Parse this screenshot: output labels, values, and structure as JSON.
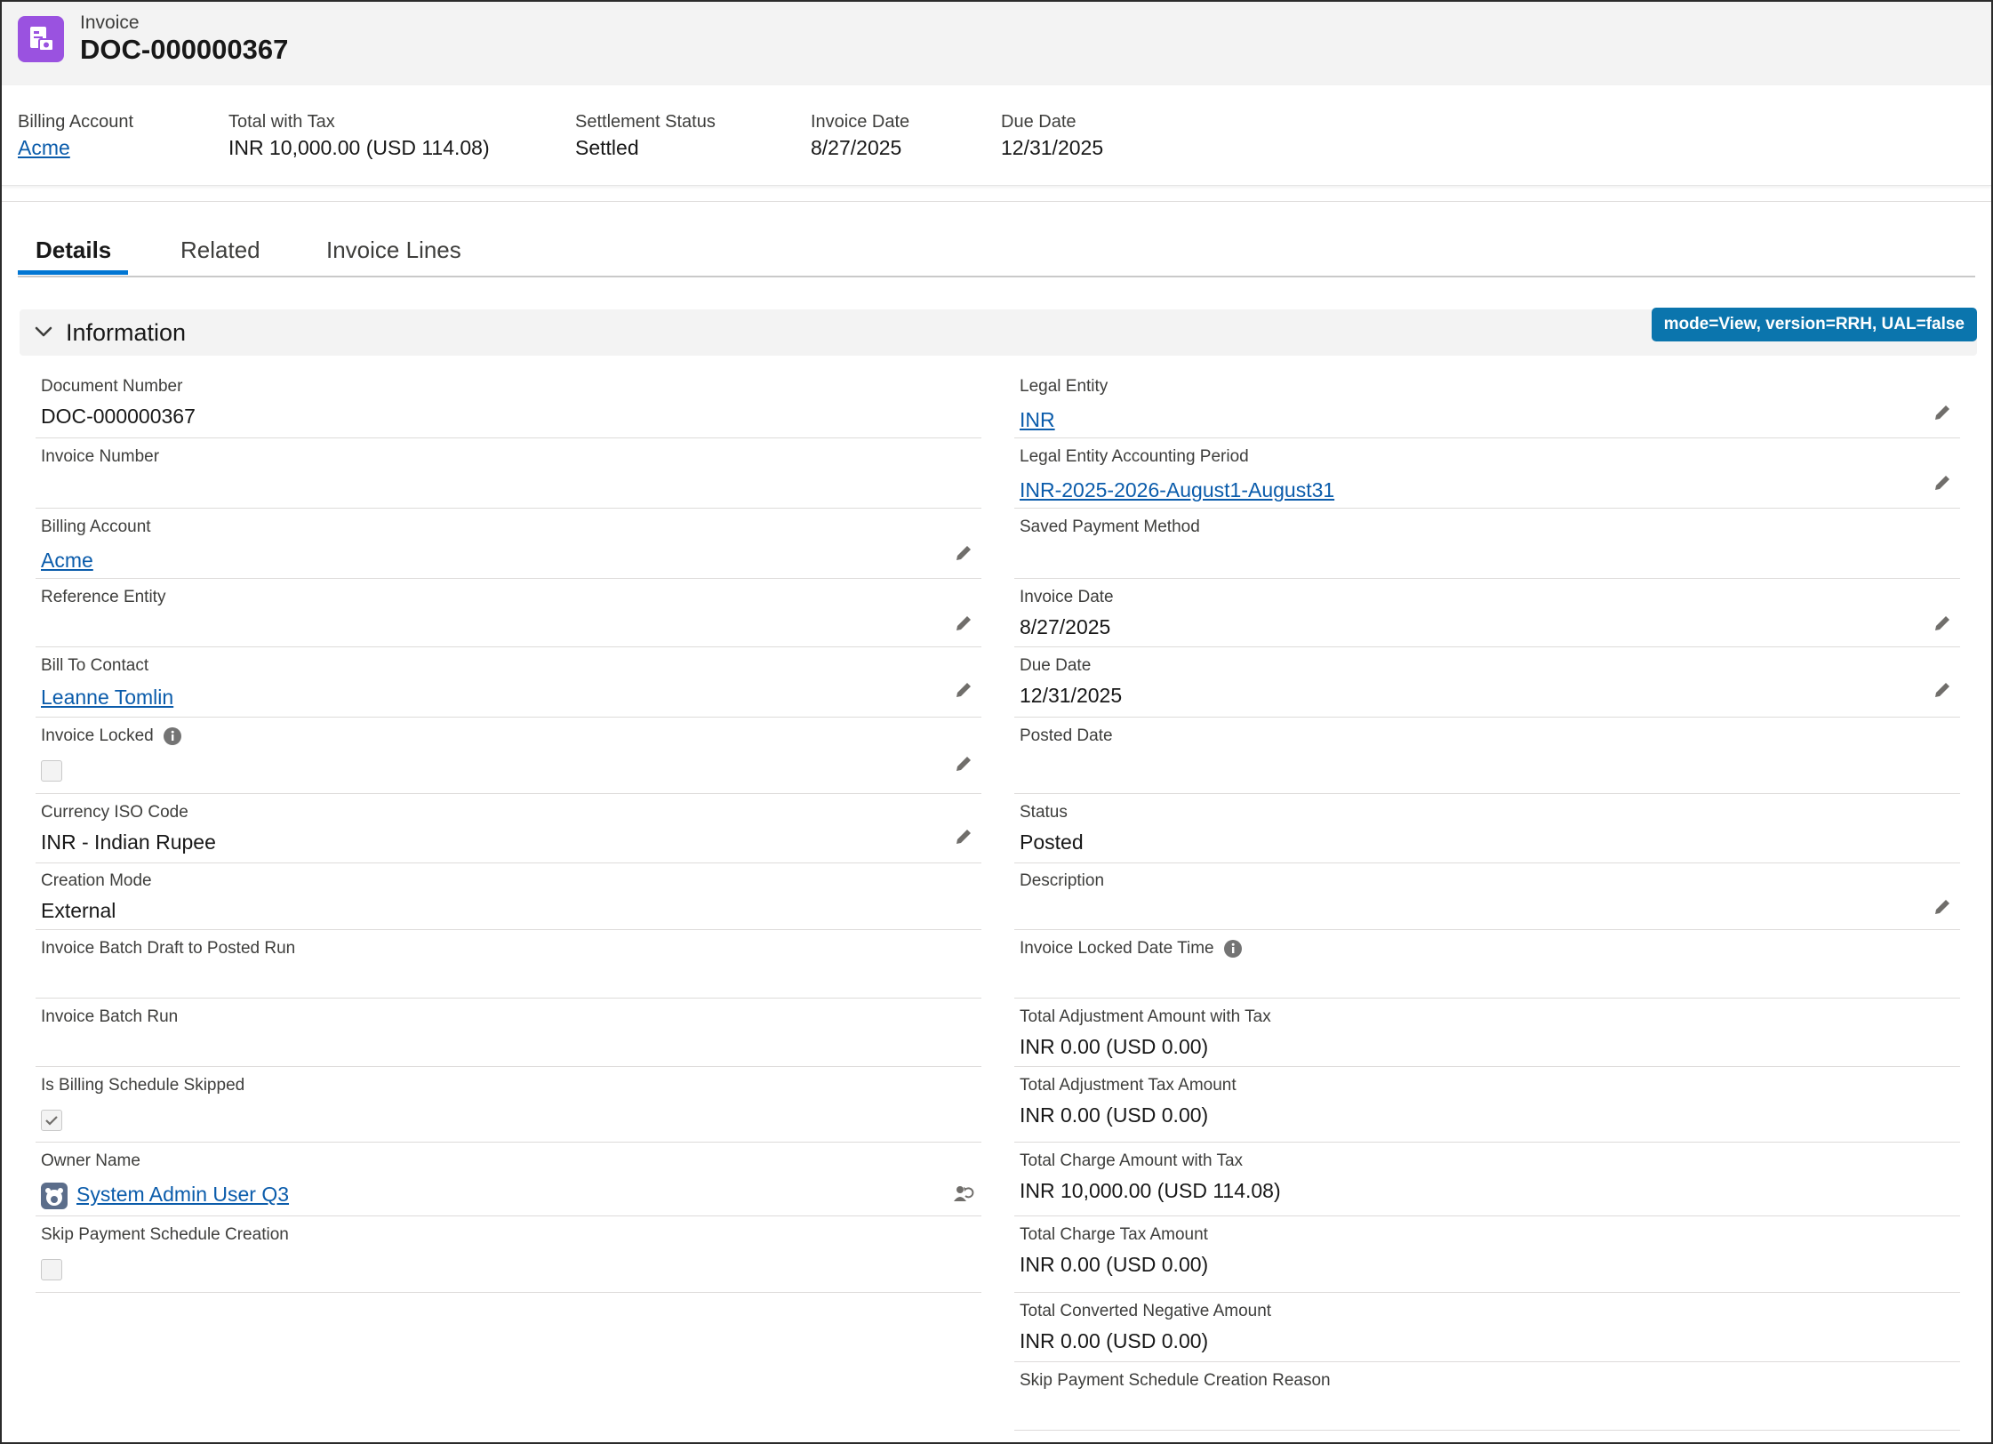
{
  "header": {
    "object_type": "Invoice",
    "record_title": "DOC-000000367"
  },
  "highlights": [
    {
      "label": "Billing Account",
      "value": "Acme",
      "link": true
    },
    {
      "label": "Total with Tax",
      "value": "INR 10,000.00 (USD 114.08)"
    },
    {
      "label": "Settlement Status",
      "value": "Settled"
    },
    {
      "label": "Invoice Date",
      "value": "8/27/2025"
    },
    {
      "label": "Due Date",
      "value": "12/31/2025"
    }
  ],
  "tabs": [
    "Details",
    "Related",
    "Invoice Lines"
  ],
  "section": {
    "title": "Information",
    "badge": "mode=View, version=RRH, UAL=false"
  },
  "left_fields": [
    {
      "label": "Document Number",
      "value": "DOC-000000367"
    },
    {
      "label": "Invoice Number",
      "value": ""
    },
    {
      "label": "Billing Account",
      "value": "Acme",
      "link": true,
      "editable": true
    },
    {
      "label": "Reference Entity",
      "value": "",
      "editable": true
    },
    {
      "label": "Bill To Contact",
      "value": "Leanne Tomlin",
      "link": true,
      "editable": true
    },
    {
      "label": "Invoice Locked",
      "value": "",
      "checkbox": true,
      "checked": false,
      "info": true,
      "editable": true
    },
    {
      "label": "Currency ISO Code",
      "value": "INR - Indian Rupee",
      "editable": true
    },
    {
      "label": "Creation Mode",
      "value": "External"
    },
    {
      "label": "Invoice Batch Draft to Posted Run",
      "value": ""
    },
    {
      "label": "Invoice Batch Run",
      "value": ""
    },
    {
      "label": "Is Billing Schedule Skipped",
      "value": "",
      "checkbox": true,
      "checked": true
    },
    {
      "label": "Owner Name",
      "value": "System Admin User Q3",
      "link": true,
      "owner": true
    },
    {
      "label": "Skip Payment Schedule Creation",
      "value": "",
      "checkbox": true,
      "checked": false
    }
  ],
  "right_fields": [
    {
      "label": "Legal Entity",
      "value": "INR",
      "link": true,
      "editable": true
    },
    {
      "label": "Legal Entity Accounting Period",
      "value": "INR-2025-2026-August1-August31",
      "link": true,
      "editable": true
    },
    {
      "label": "Saved Payment Method",
      "value": ""
    },
    {
      "label": "Invoice Date",
      "value": "8/27/2025",
      "editable": true
    },
    {
      "label": "Due Date",
      "value": "12/31/2025",
      "editable": true
    },
    {
      "label": "Posted Date",
      "value": ""
    },
    {
      "label": "Status",
      "value": "Posted"
    },
    {
      "label": "Description",
      "value": "",
      "editable": true
    },
    {
      "label": "Invoice Locked Date Time",
      "value": "",
      "info": true
    },
    {
      "label": "Total Adjustment Amount with Tax",
      "value": "INR 0.00 (USD 0.00)"
    },
    {
      "label": "Total Adjustment Tax Amount",
      "value": "INR 0.00 (USD 0.00)"
    },
    {
      "label": "Total Charge Amount with Tax",
      "value": "INR 10,000.00 (USD 114.08)"
    },
    {
      "label": "Total Charge Tax Amount",
      "value": "INR 0.00 (USD 0.00)"
    },
    {
      "label": "Total Converted Negative Amount",
      "value": "INR 0.00 (USD 0.00)"
    },
    {
      "label": "Skip Payment Schedule Creation Reason",
      "value": ""
    }
  ]
}
